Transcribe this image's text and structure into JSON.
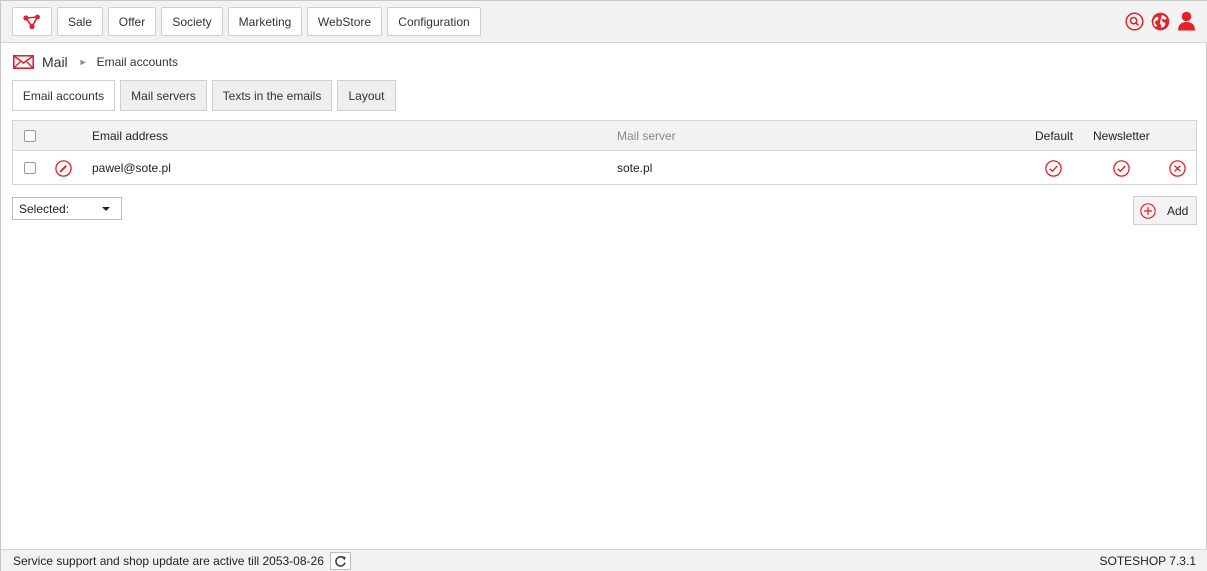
{
  "nav": {
    "items": [
      {
        "label": "Sale"
      },
      {
        "label": "Offer"
      },
      {
        "label": "Society"
      },
      {
        "label": "Marketing"
      },
      {
        "label": "WebStore"
      },
      {
        "label": "Configuration"
      }
    ]
  },
  "breadcrumb": {
    "section": "Mail",
    "current": "Email accounts"
  },
  "tabs": [
    {
      "label": "Email accounts",
      "active": true
    },
    {
      "label": "Mail servers"
    },
    {
      "label": "Texts in the emails"
    },
    {
      "label": "Layout"
    }
  ],
  "table": {
    "headers": {
      "email": "Email address",
      "server": "Mail server",
      "default": "Default",
      "newsletter": "Newsletter"
    },
    "rows": [
      {
        "email": "pawel@sote.pl",
        "server": "sote.pl",
        "default": true,
        "newsletter": true
      }
    ]
  },
  "actions": {
    "selected_label": "Selected:",
    "add_label": "Add"
  },
  "footer": {
    "status": "Service support and shop update are active till 2053-08-26",
    "version": "SOTESHOP 7.3.1"
  },
  "colors": {
    "accent": "#e2232a",
    "border": "#cfcfcf",
    "bar": "#f2f2f2"
  }
}
